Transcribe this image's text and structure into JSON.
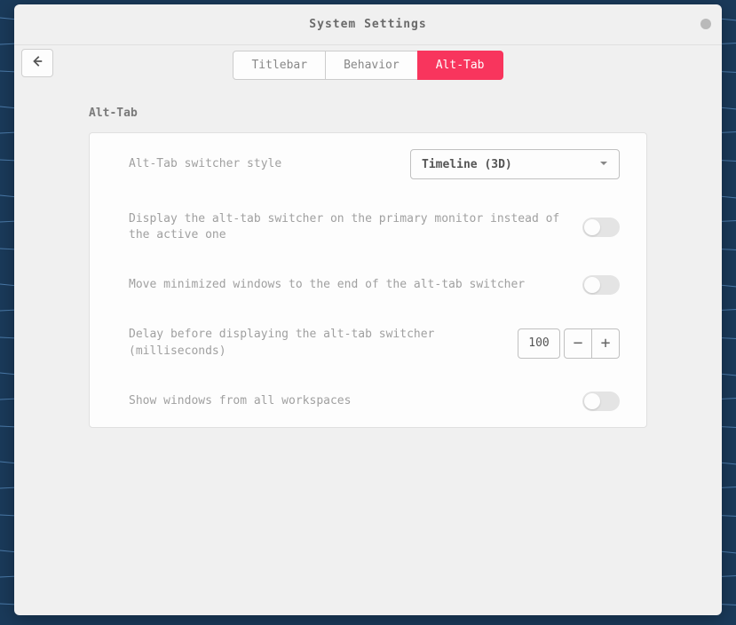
{
  "window": {
    "title": "System Settings"
  },
  "tabs": [
    {
      "label": "Titlebar",
      "active": false
    },
    {
      "label": "Behavior",
      "active": false
    },
    {
      "label": "Alt-Tab",
      "active": true
    }
  ],
  "section": {
    "title": "Alt-Tab",
    "rows": {
      "switcher_style": {
        "label": "Alt-Tab switcher style",
        "value": "Timeline (3D)"
      },
      "primary_monitor": {
        "label": "Display the alt-tab switcher on the primary monitor instead of the active one",
        "value": false
      },
      "move_minimized": {
        "label": "Move minimized windows to the end of the alt-tab switcher",
        "value": false
      },
      "delay": {
        "label": "Delay before displaying the alt-tab switcher (milliseconds)",
        "value": "100"
      },
      "all_workspaces": {
        "label": "Show windows from all workspaces",
        "value": false
      }
    }
  }
}
